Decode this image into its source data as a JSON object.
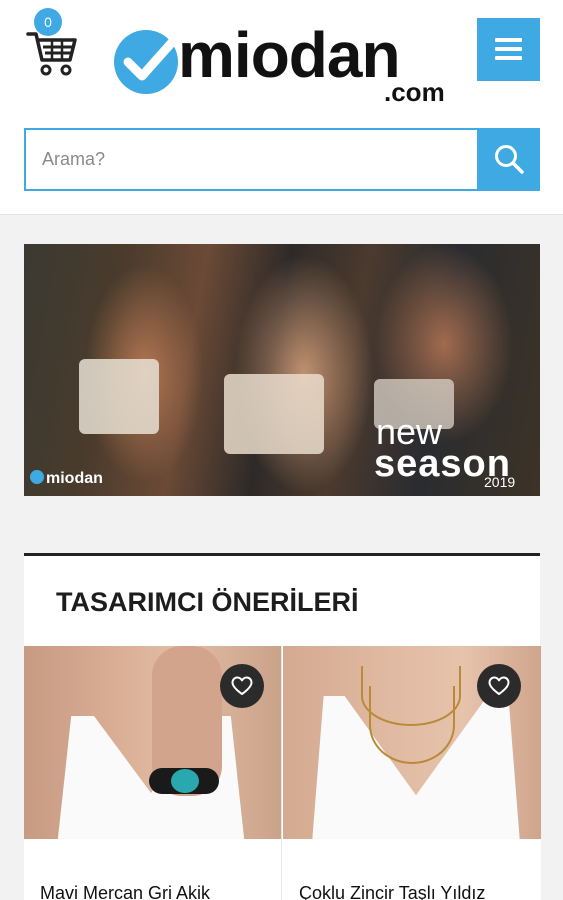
{
  "header": {
    "cart_count": "0",
    "logo_text": "miodan",
    "logo_sub": ".com"
  },
  "search": {
    "placeholder": "Arama?"
  },
  "banner": {
    "logo_text": "miodan",
    "headline_1": "new",
    "headline_2": "season",
    "year": "2019"
  },
  "section": {
    "title": "TASARIMCI ÖNERİLERİ",
    "products": [
      {
        "name": "Mavi Mercan Gri Akik"
      },
      {
        "name": "Çoklu Zincir Taşlı Yıldız"
      }
    ]
  },
  "colors": {
    "accent": "#3fa9e3",
    "fav_button": "#2b2b2b",
    "section_border": "#222222"
  }
}
